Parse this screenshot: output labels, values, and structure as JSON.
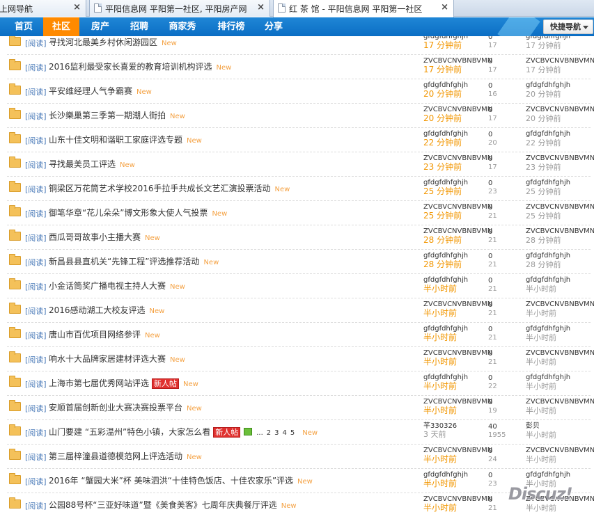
{
  "browser_tabs": [
    {
      "title": "上网导航",
      "active": false
    },
    {
      "title": "平阳信息网 平阳第一社区, 平阳房产网",
      "active": false
    },
    {
      "title": "红 茶 馆 - 平阳信息网 平阳第一社区",
      "active": true
    }
  ],
  "tab_close_glyph": "×",
  "nav": {
    "items": [
      "首页",
      "社区",
      "房产",
      "招聘",
      "商家秀",
      "排行榜",
      "分享"
    ],
    "active_index": 1,
    "quick_nav": "快捷导航"
  },
  "thread_tag": "[阅读]",
  "new_label": "New",
  "hot_label": "新人帖",
  "threads": [
    {
      "title": "寻找河北最美乡村休闲游园区",
      "author": "gfdgfdhfghjh",
      "time": "17 分钟前",
      "replies": "0",
      "views": "17",
      "last_by": "gfdgfdhfghjh",
      "last_time": "17 分钟前"
    },
    {
      "title": "2016监利最受家长喜爱的教育培训机构评选",
      "author": "ZVCBVCNVBNBVMN",
      "time": "17 分钟前",
      "replies": "0",
      "views": "17",
      "last_by": "ZVCBVCNVBNBVMN",
      "last_time": "17 分钟前"
    },
    {
      "title": "平安维经理人气争霸赛",
      "author": "gfdgfdhfghjh",
      "time": "20 分钟前",
      "replies": "0",
      "views": "16",
      "last_by": "gfdgfdhfghjh",
      "last_time": "20 分钟前"
    },
    {
      "title": "长沙樂巢第三季第一期潮人街拍",
      "author": "ZVCBVCNVBNBVMN",
      "time": "20 分钟前",
      "replies": "0",
      "views": "17",
      "last_by": "ZVCBVCNVBNBVMN",
      "last_time": "20 分钟前"
    },
    {
      "title": "山东十佳文明和谐职工家庭评选专题",
      "author": "gfdgfdhfghjh",
      "time": "22 分钟前",
      "replies": "0",
      "views": "20",
      "last_by": "gfdgfdhfghjh",
      "last_time": "22 分钟前"
    },
    {
      "title": "寻找最美员工评选",
      "author": "ZVCBVCNVBNBVMN",
      "time": "23 分钟前",
      "replies": "0",
      "views": "17",
      "last_by": "ZVCBVCNVBNBVMN",
      "last_time": "23 分钟前"
    },
    {
      "title": "铜梁区万花筒艺术学校2016手拉手共成长文艺汇演投票活动",
      "author": "gfdgfdhfghjh",
      "time": "25 分钟前",
      "replies": "0",
      "views": "23",
      "last_by": "gfdgfdhfghjh",
      "last_time": "25 分钟前"
    },
    {
      "title": "御笔华章“花儿朵朵”博文形象大使人气投票",
      "author": "ZVCBVCNVBNBVMN",
      "time": "25 分钟前",
      "replies": "0",
      "views": "21",
      "last_by": "ZVCBVCNVBNBVMN",
      "last_time": "25 分钟前"
    },
    {
      "title": "西瓜哥哥故事小主播大赛",
      "author": "ZVCBVCNVBNBVMN",
      "time": "28 分钟前",
      "replies": "0",
      "views": "21",
      "last_by": "ZVCBVCNVBNBVMN",
      "last_time": "28 分钟前"
    },
    {
      "title": "新昌县县直机关“先锋工程”评选推荐活动",
      "author": "gfdgfdhfghjh",
      "time": "28 分钟前",
      "replies": "0",
      "views": "21",
      "last_by": "gfdgfdhfghjh",
      "last_time": "28 分钟前"
    },
    {
      "title": "小金话筒奖广播电视主持人大赛",
      "author": "gfdgfdhfghjh",
      "time": "半小时前",
      "replies": "0",
      "views": "21",
      "last_by": "gfdgfdhfghjh",
      "last_time": "半小时前"
    },
    {
      "title": "2016感动湖工大校友评选",
      "author": "ZVCBVCNVBNBVMN",
      "time": "半小时前",
      "replies": "0",
      "views": "21",
      "last_by": "ZVCBVCNVBNBVMN",
      "last_time": "半小时前"
    },
    {
      "title": "唐山市百优项目网络参评",
      "author": "gfdgfdhfghjh",
      "time": "半小时前",
      "replies": "0",
      "views": "21",
      "last_by": "gfdgfdhfghjh",
      "last_time": "半小时前"
    },
    {
      "title": "响水十大品牌家居建材评选大赛",
      "author": "ZVCBVCNVBNBVMN",
      "time": "半小时前",
      "replies": "0",
      "views": "21",
      "last_by": "ZVCBVCNVBNBVMN",
      "last_time": "半小时前"
    },
    {
      "title": "上海市第七届优秀网站评选",
      "hot": true,
      "author": "gfdgfdhfghjh",
      "time": "半小时前",
      "replies": "0",
      "views": "22",
      "last_by": "gfdgfdhfghjh",
      "last_time": "半小时前"
    },
    {
      "title": "安顺首届创新创业大赛决赛投票平台",
      "author": "ZVCBVCNVBNBVMN",
      "time": "半小时前",
      "replies": "0",
      "views": "19",
      "last_by": "ZVCBVCNVBNBVMN",
      "last_time": "半小时前"
    },
    {
      "title": "山门要建 “五彩温州”特色小镇，大家怎么看",
      "hot": true,
      "has_image": true,
      "pages": [
        "...",
        "2",
        "3",
        "4",
        "5"
      ],
      "author": "芊330326",
      "time": "3 天前",
      "time_gray": true,
      "replies": "40",
      "views": "1955",
      "last_by": "彭贝",
      "last_time": "半小时前"
    },
    {
      "title": "第三届梓潼县道德模范网上评选活动",
      "author": "ZVCBVCNVBNBVMN",
      "time": "半小时前",
      "replies": "0",
      "views": "24",
      "last_by": "ZVCBVCNVBNBVMN",
      "last_time": "半小时前"
    },
    {
      "title": "2016年 “蟹园大米”杯 美味泗洪“十佳特色饭店、十佳农家乐”评选",
      "author": "gfdgfdhfghjh",
      "time": "半小时前",
      "replies": "0",
      "views": "23",
      "last_by": "gfdgfdhfghjh",
      "last_time": "半小时前"
    },
    {
      "title": "公园88号杯“三亚好味道”暨《美食美客》七周年庆典餐厅评选",
      "author": "ZVCBVCNVBNBVMN",
      "time": "半小时前",
      "replies": "0",
      "views": "21",
      "last_by": "ZVCBVCNVBNBVMN",
      "last_time": "半小时前"
    }
  ],
  "watermark": "Discuz!"
}
